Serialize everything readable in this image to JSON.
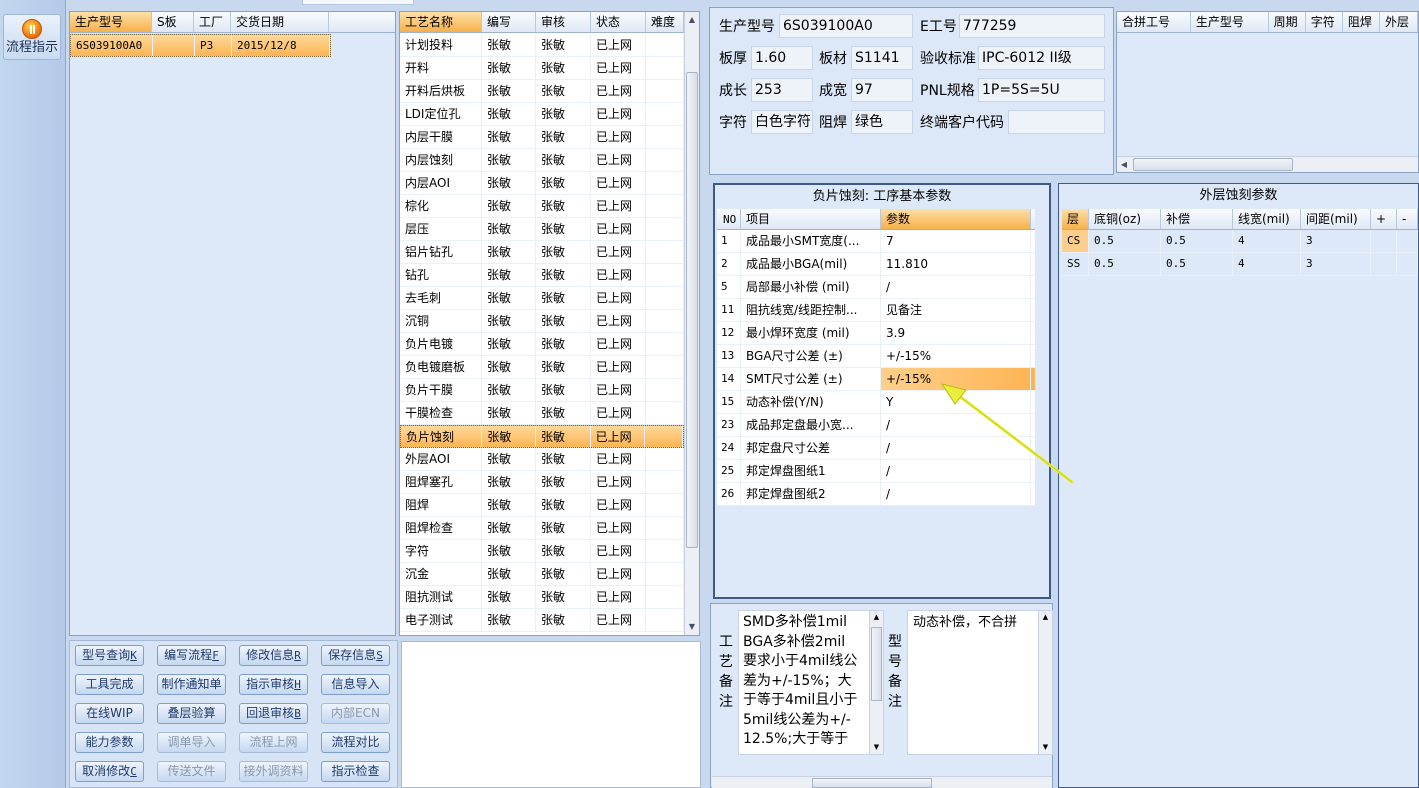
{
  "left_toolbar": {
    "flow_button_label": "流程指示"
  },
  "model_list": {
    "headers": [
      "生产型号",
      "S板",
      "工厂",
      "交货日期"
    ],
    "rows": [
      [
        "6S039100A0",
        "",
        "P3",
        "2015/12/8"
      ]
    ]
  },
  "process_list": {
    "headers": [
      "工艺名称",
      "编写",
      "审核",
      "状态",
      "难度"
    ],
    "rows": [
      [
        "计划投料",
        "张敏",
        "张敏",
        "已上网",
        ""
      ],
      [
        "开料",
        "张敏",
        "张敏",
        "已上网",
        ""
      ],
      [
        "开料后烘板",
        "张敏",
        "张敏",
        "已上网",
        ""
      ],
      [
        "LDI定位孔",
        "张敏",
        "张敏",
        "已上网",
        ""
      ],
      [
        "内层干膜",
        "张敏",
        "张敏",
        "已上网",
        ""
      ],
      [
        "内层蚀刻",
        "张敏",
        "张敏",
        "已上网",
        ""
      ],
      [
        "内层AOI",
        "张敏",
        "张敏",
        "已上网",
        ""
      ],
      [
        "棕化",
        "张敏",
        "张敏",
        "已上网",
        ""
      ],
      [
        "层压",
        "张敏",
        "张敏",
        "已上网",
        ""
      ],
      [
        "铝片钻孔",
        "张敏",
        "张敏",
        "已上网",
        ""
      ],
      [
        "钻孔",
        "张敏",
        "张敏",
        "已上网",
        ""
      ],
      [
        "去毛刺",
        "张敏",
        "张敏",
        "已上网",
        ""
      ],
      [
        "沉铜",
        "张敏",
        "张敏",
        "已上网",
        ""
      ],
      [
        "负片电镀",
        "张敏",
        "张敏",
        "已上网",
        ""
      ],
      [
        "负电镀磨板",
        "张敏",
        "张敏",
        "已上网",
        ""
      ],
      [
        "负片干膜",
        "张敏",
        "张敏",
        "已上网",
        ""
      ],
      [
        "干膜检查",
        "张敏",
        "张敏",
        "已上网",
        ""
      ],
      [
        "负片蚀刻",
        "张敏",
        "张敏",
        "已上网",
        ""
      ],
      [
        "外层AOI",
        "张敏",
        "张敏",
        "已上网",
        ""
      ],
      [
        "阻焊塞孔",
        "张敏",
        "张敏",
        "已上网",
        ""
      ],
      [
        "阻焊",
        "张敏",
        "张敏",
        "已上网",
        ""
      ],
      [
        "阻焊检查",
        "张敏",
        "张敏",
        "已上网",
        ""
      ],
      [
        "字符",
        "张敏",
        "张敏",
        "已上网",
        ""
      ],
      [
        "沉金",
        "张敏",
        "张敏",
        "已上网",
        ""
      ],
      [
        "阻抗测试",
        "张敏",
        "张敏",
        "已上网",
        ""
      ],
      [
        "电子测试",
        "张敏",
        "张敏",
        "已上网",
        ""
      ]
    ]
  },
  "buttons": [
    {
      "label": "型号查询",
      "key": "K",
      "enabled": true
    },
    {
      "label": "编写流程",
      "key": "F",
      "enabled": true
    },
    {
      "label": "修改信息",
      "key": "R",
      "enabled": true
    },
    {
      "label": "保存信息",
      "key": "S",
      "enabled": true
    },
    {
      "label": "工具完成",
      "key": "",
      "enabled": true
    },
    {
      "label": "制作通知单",
      "key": "",
      "enabled": true
    },
    {
      "label": "指示审核",
      "key": "H",
      "enabled": true
    },
    {
      "label": "信息导入",
      "key": "",
      "enabled": true
    },
    {
      "label": "在线WIP",
      "key": "",
      "enabled": true
    },
    {
      "label": "叠层验算",
      "key": "",
      "enabled": true
    },
    {
      "label": "回退审核",
      "key": "B",
      "enabled": true
    },
    {
      "label": "内部ECN",
      "key": "",
      "enabled": false
    },
    {
      "label": "能力参数",
      "key": "",
      "enabled": true
    },
    {
      "label": "调单导入",
      "key": "",
      "enabled": false
    },
    {
      "label": "流程上网",
      "key": "",
      "enabled": false
    },
    {
      "label": "流程对比",
      "key": "",
      "enabled": true
    },
    {
      "label": "取消修改",
      "key": "C",
      "enabled": true
    },
    {
      "label": "传送文件",
      "key": "",
      "enabled": false
    },
    {
      "label": "接外调资料",
      "key": "",
      "enabled": false
    },
    {
      "label": "指示检查",
      "key": "",
      "enabled": true
    }
  ],
  "info": {
    "model_label": "生产型号",
    "model_value": "6S039100A0",
    "e_label": "E工号",
    "e_value": "777259",
    "thickness_label": "板厚",
    "thickness_value": "1.60",
    "material_label": "板材",
    "material_value": "S1141",
    "standard_label": "验收标准",
    "standard_value": "IPC-6012 II级",
    "length_label": "成长",
    "length_value": "253",
    "width_label": "成宽",
    "width_value": "97",
    "pnl_label": "PNL规格",
    "pnl_value": "1P=5S=5U",
    "char_label": "字符",
    "char_value": "白色字符",
    "mask_label": "阻焊",
    "mask_value": "绿色",
    "customer_label": "终端客户代码",
    "customer_value": ""
  },
  "combine_table": {
    "headers": [
      "合拼工号",
      "生产型号",
      "周期",
      "字符",
      "阻焊",
      "外层"
    ]
  },
  "param_panel": {
    "title": "负片蚀刻: 工序基本参数",
    "headers": [
      "NO",
      "项目",
      "参数"
    ],
    "rows": [
      [
        "1",
        "成品最小SMT宽度(...",
        "7"
      ],
      [
        "2",
        "成品最小BGA(mil)",
        "11.810"
      ],
      [
        "5",
        "局部最小补偿 (mil)",
        "/"
      ],
      [
        "11",
        "阻抗线宽/线距控制...",
        "见备注"
      ],
      [
        "12",
        "最小焊环宽度 (mil)",
        "3.9"
      ],
      [
        "13",
        "BGA尺寸公差 (±)",
        "+/-15%"
      ],
      [
        "14",
        "SMT尺寸公差 (±)",
        "+/-15%"
      ],
      [
        "15",
        "动态补偿(Y/N)",
        "Y"
      ],
      [
        "23",
        "成品邦定盘最小宽...",
        "/"
      ],
      [
        "24",
        "邦定盘尺寸公差",
        "/"
      ],
      [
        "25",
        "邦定焊盘图纸1",
        "/"
      ],
      [
        "26",
        "邦定焊盘图纸2",
        "/"
      ]
    ]
  },
  "outer_panel": {
    "title": "外层蚀刻参数",
    "headers": [
      "层",
      "底铜(oz)",
      "补偿",
      "线宽(mil)",
      "间距(mil)",
      "+",
      "-"
    ],
    "rows": [
      [
        "CS",
        "0.5",
        "0.5",
        "4",
        "3",
        "",
        ""
      ],
      [
        "SS",
        "0.5",
        "0.5",
        "4",
        "3",
        "",
        ""
      ]
    ]
  },
  "notes": {
    "process_note_label": "工艺备注",
    "process_note_lines": [
      "SMD多补偿1mil",
      "BGA多补偿2mil",
      "要求小于4mil线公",
      "差为+/-15%；大",
      "于等于4mil且小于",
      "5mil线公差为+/-",
      "12.5%;大于等于"
    ],
    "model_note_label": "型号备注",
    "model_note_text": "动态补偿，不合拼"
  },
  "colors": {
    "selection": "#fdb454",
    "header_sel": "#f7b04a",
    "panel": "#dce8f8",
    "arrow": "#e8ee3a"
  }
}
